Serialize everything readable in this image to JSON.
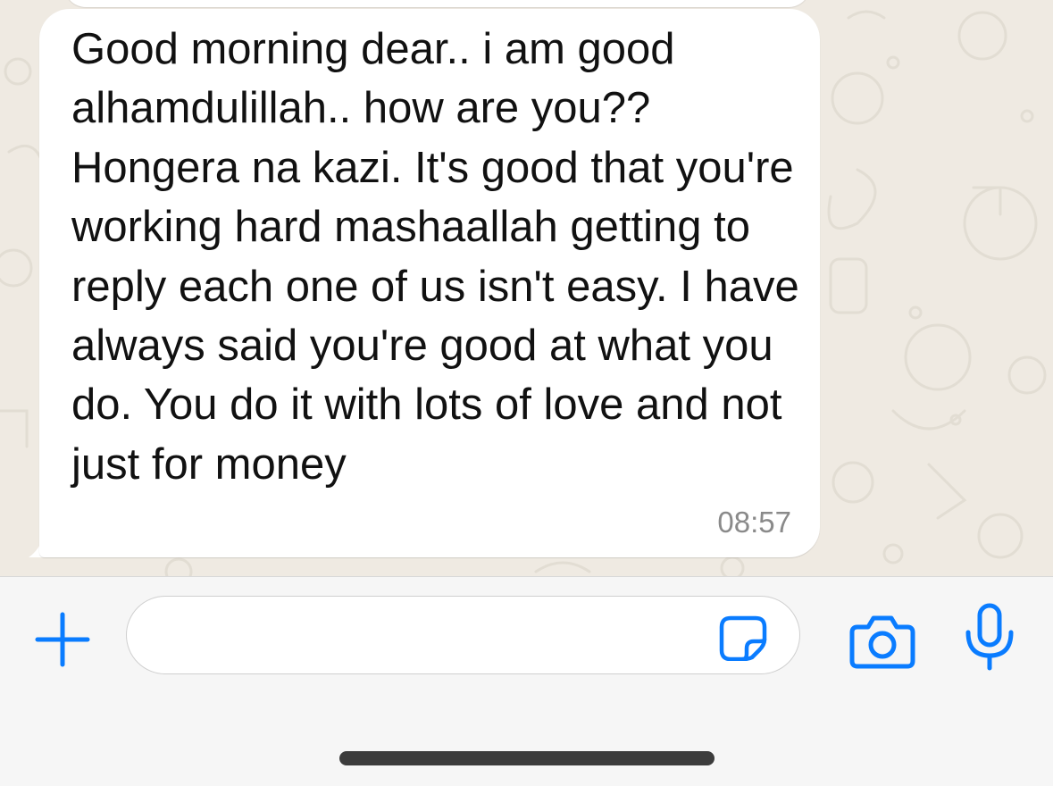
{
  "message": {
    "text": "Good morning dear.. i am good alhamdulillah.. how are you?? Hongera na kazi. It's good that you're working hard mashaallah getting to reply each one of us isn't easy. I have always said you're good at what you do. You do it with lots of love and not just for money",
    "time": "08:57"
  },
  "composer": {
    "input_value": "",
    "icons": {
      "attach": "plus-icon",
      "sticker": "sticker-icon",
      "camera": "camera-icon",
      "mic": "microphone-icon"
    }
  },
  "colors": {
    "accent": "#0a7cff",
    "chat_background": "#efeae2",
    "bubble": "#ffffff",
    "timestamp": "#8a8a8a",
    "bar_background": "#f6f6f6"
  }
}
